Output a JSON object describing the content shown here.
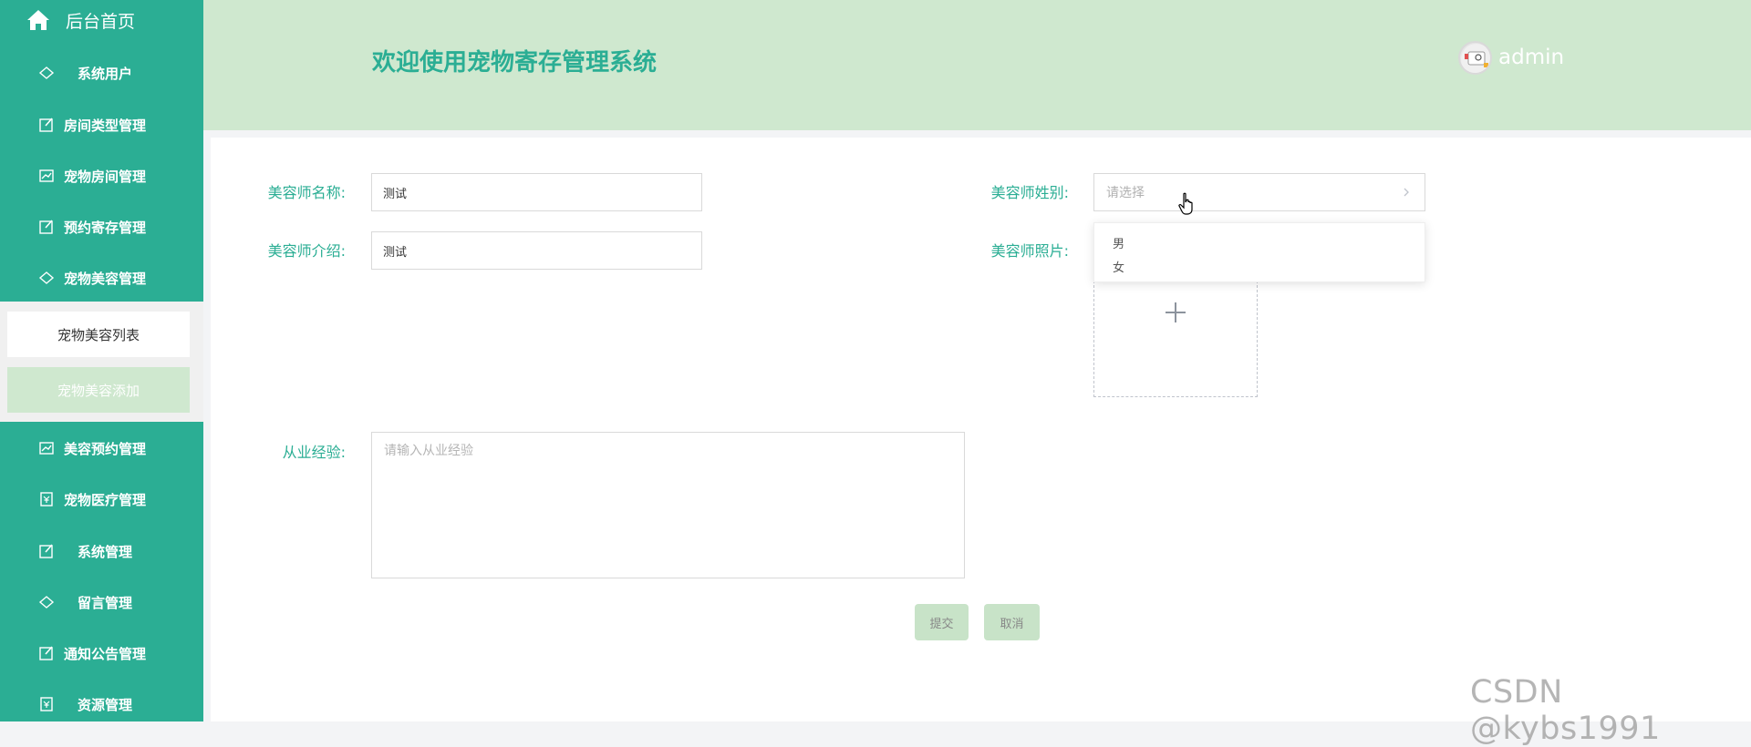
{
  "sidebar": {
    "home_label": "后台首页",
    "items": [
      {
        "label": "系统用户",
        "icon": "diamond-icon"
      },
      {
        "label": "房间类型管理",
        "icon": "edit-icon"
      },
      {
        "label": "宠物房间管理",
        "icon": "chart-icon"
      },
      {
        "label": "预约寄存管理",
        "icon": "edit-icon"
      },
      {
        "label": "宠物美容管理",
        "icon": "diamond-icon"
      },
      {
        "label": "美容预约管理",
        "icon": "chart-icon"
      },
      {
        "label": "宠物医疗管理",
        "icon": "money-icon"
      },
      {
        "label": "系统管理",
        "icon": "edit-icon"
      },
      {
        "label": "留言管理",
        "icon": "diamond-icon"
      },
      {
        "label": "通知公告管理",
        "icon": "edit-icon"
      },
      {
        "label": "资源管理",
        "icon": "money-icon"
      }
    ],
    "submenu": {
      "list_label": "宠物美容列表",
      "add_label": "宠物美容添加"
    }
  },
  "header": {
    "title": "欢迎使用宠物寄存管理系统",
    "username": "admin"
  },
  "form": {
    "name_label": "美容师名称:",
    "name_value": "测试",
    "intro_label": "美容师介绍:",
    "intro_value": "测试",
    "gender_label": "美容师姓别:",
    "gender_placeholder": "请选择",
    "gender_options": [
      "男",
      "女"
    ],
    "photo_label": "美容师照片:",
    "experience_label": "从业经验:",
    "experience_placeholder": "请输入从业经验",
    "submit_label": "提交",
    "cancel_label": "取消"
  },
  "watermark": "CSDN @kybs1991",
  "colors": {
    "primary": "#2bae94",
    "header_bg": "#cfe8cf",
    "button_bg": "#c8e3c8"
  }
}
